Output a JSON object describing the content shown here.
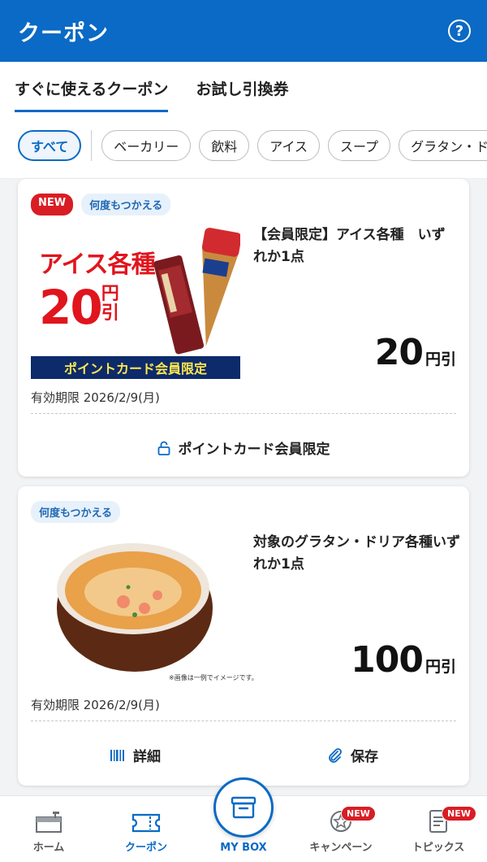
{
  "appbar": {
    "title": "クーポン",
    "help_icon": "question-circle-icon",
    "help_glyph": "?"
  },
  "tabs": [
    {
      "label": "すぐに使えるクーポン",
      "active": true
    },
    {
      "label": "お試し引換券",
      "active": false
    }
  ],
  "filters": [
    "すべて",
    "ベーカリー",
    "飲料",
    "アイス",
    "スープ",
    "グラタン・ドリア"
  ],
  "coupons": [
    {
      "badge_new": "NEW",
      "badge_reuse": "何度もつかえる",
      "image_lines": {
        "line1": "アイス各種",
        "amount": "20",
        "unit_top": "円",
        "unit_bottom": "引",
        "banner": "ポイントカード会員限定"
      },
      "title": "【会員限定】アイス各種　いずれか1点",
      "discount_value": "20",
      "discount_unit": "円引",
      "expiry": "有効期限 2026/2/9(月)",
      "footer_label": "ポイントカード会員限定"
    },
    {
      "badge_reuse": "何度もつかえる",
      "image_caption": "※画像は一例でイメージです。",
      "title": "対象のグラタン・ドリア各種いずれか1点",
      "discount_value": "100",
      "discount_unit": "円引",
      "expiry": "有効期限 2026/2/9(月)",
      "detail_label": "詳細",
      "save_label": "保存"
    }
  ],
  "bottom_nav": {
    "home": "ホーム",
    "coupon": "クーポン",
    "mybox": "MY BOX",
    "campaign": "キャンペーン",
    "topics": "トピックス",
    "new_badge": "NEW"
  },
  "colors": {
    "brand_blue": "#0a6ac5",
    "badge_red": "#d91d24"
  }
}
